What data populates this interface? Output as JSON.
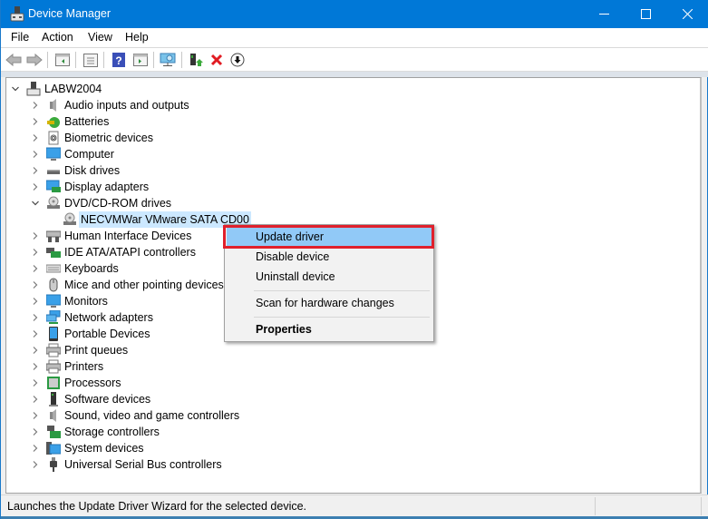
{
  "window": {
    "title": "Device Manager",
    "controls": {
      "minimize": "minimize",
      "maximize": "maximize",
      "close": "close"
    }
  },
  "menu": [
    "File",
    "Action",
    "View",
    "Help"
  ],
  "toolbar": {
    "buttons": [
      {
        "name": "back-button",
        "icon": "arrow-left-icon"
      },
      {
        "name": "forward-button",
        "icon": "arrow-right-icon"
      },
      {
        "name": "show-hide-console-tree-button",
        "icon": "console-tree-icon"
      },
      {
        "name": "properties-button",
        "icon": "properties-sheet-icon"
      },
      {
        "name": "help-button",
        "icon": "help-icon"
      },
      {
        "name": "show-action-pane-button",
        "icon": "action-pane-icon"
      },
      {
        "name": "scan-hardware-button",
        "icon": "monitor-scan-icon"
      },
      {
        "name": "update-driver-button",
        "icon": "update-driver-icon"
      },
      {
        "name": "uninstall-device-button",
        "icon": "red-x-icon"
      },
      {
        "name": "disable-device-button",
        "icon": "down-arrow-circle-icon"
      }
    ]
  },
  "tree": {
    "root": "LABW2004",
    "categories": [
      {
        "label": "Audio inputs and outputs",
        "icon": "speaker-icon",
        "expanded": false
      },
      {
        "label": "Batteries",
        "icon": "battery-icon",
        "expanded": false
      },
      {
        "label": "Biometric devices",
        "icon": "fingerprint-icon",
        "expanded": false
      },
      {
        "label": "Computer",
        "icon": "computer-icon",
        "expanded": false
      },
      {
        "label": "Disk drives",
        "icon": "disk-drive-icon",
        "expanded": false
      },
      {
        "label": "Display adapters",
        "icon": "display-adapter-icon",
        "expanded": false
      },
      {
        "label": "DVD/CD-ROM drives",
        "icon": "dvd-drive-icon",
        "expanded": true,
        "children": [
          {
            "label": "NECVMWar VMware SATA CD00",
            "icon": "dvd-drive-icon",
            "selected": true
          }
        ]
      },
      {
        "label": "Human Interface Devices",
        "icon": "hid-icon",
        "expanded": false
      },
      {
        "label": "IDE ATA/ATAPI controllers",
        "icon": "ide-controller-icon",
        "expanded": false
      },
      {
        "label": "Keyboards",
        "icon": "keyboard-icon",
        "expanded": false
      },
      {
        "label": "Mice and other pointing devices",
        "icon": "mouse-icon",
        "expanded": false
      },
      {
        "label": "Monitors",
        "icon": "monitor-icon",
        "expanded": false
      },
      {
        "label": "Network adapters",
        "icon": "network-adapter-icon",
        "expanded": false
      },
      {
        "label": "Portable Devices",
        "icon": "portable-device-icon",
        "expanded": false
      },
      {
        "label": "Print queues",
        "icon": "printer-icon",
        "expanded": false
      },
      {
        "label": "Printers",
        "icon": "printer-icon",
        "expanded": false
      },
      {
        "label": "Processors",
        "icon": "processor-icon",
        "expanded": false
      },
      {
        "label": "Software devices",
        "icon": "software-device-icon",
        "expanded": false
      },
      {
        "label": "Sound, video and game controllers",
        "icon": "speaker-icon",
        "expanded": false
      },
      {
        "label": "Storage controllers",
        "icon": "storage-controller-icon",
        "expanded": false
      },
      {
        "label": "System devices",
        "icon": "system-device-icon",
        "expanded": false
      },
      {
        "label": "Universal Serial Bus controllers",
        "icon": "usb-icon",
        "expanded": false
      }
    ]
  },
  "context_menu": {
    "items": [
      {
        "label": "Update driver",
        "highlighted": true
      },
      {
        "label": "Disable device"
      },
      {
        "label": "Uninstall device"
      },
      {
        "separator": true
      },
      {
        "label": "Scan for hardware changes"
      },
      {
        "separator": true
      },
      {
        "label": "Properties",
        "bold": true
      }
    ]
  },
  "status": {
    "text": "Launches the Update Driver Wizard for the selected device."
  },
  "colors": {
    "titlebar": "#0078d7",
    "highlight": "#91c9f7",
    "selection": "#cce8ff",
    "annotation": "#e0202c"
  }
}
